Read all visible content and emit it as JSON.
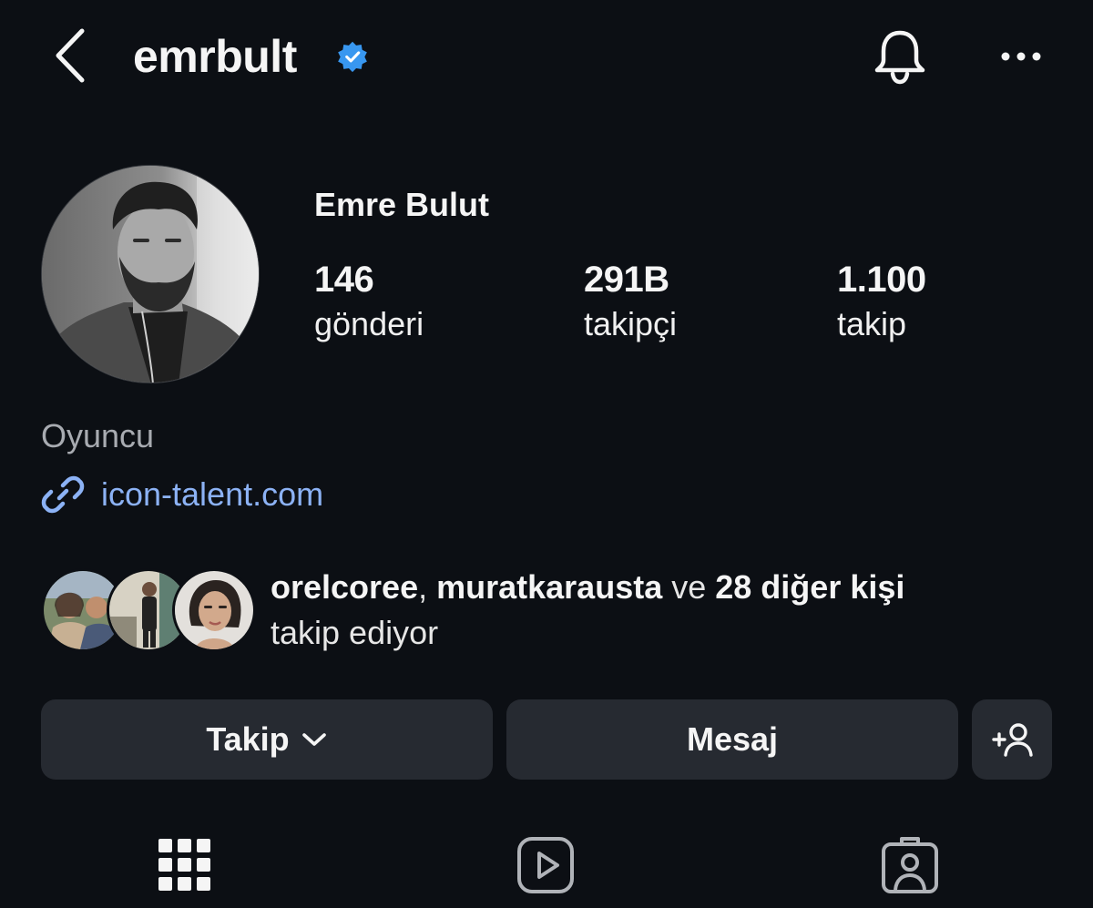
{
  "header": {
    "username": "emrbult",
    "verified": true,
    "icons": [
      "back-chevron-icon",
      "verified-badge-icon",
      "bell-icon",
      "more-options-icon"
    ]
  },
  "profile": {
    "full_name": "Emre Bulut",
    "stats": [
      {
        "number": "146",
        "label": "gönderi"
      },
      {
        "number": "291B",
        "label": "takipçi"
      },
      {
        "number": "1.100",
        "label": "takip"
      }
    ],
    "category": "Oyuncu",
    "link": "icon-talent.com"
  },
  "mutual": {
    "user1": "orelcoree",
    "separator": ", ",
    "user2": "muratkarausta",
    "conjunction": " ve ",
    "others": "28 diğer kişi",
    "suffix": "takip ediyor"
  },
  "actions": {
    "follow_label": "Takip",
    "message_label": "Mesaj"
  },
  "tabs": [
    "grid-icon",
    "reels-icon",
    "tagged-icon"
  ],
  "colors": {
    "background": "#0c0f14",
    "button": "#262a31",
    "verified": "#3897f0",
    "link": "#8cb2f5",
    "muted": "#a8abb1"
  }
}
